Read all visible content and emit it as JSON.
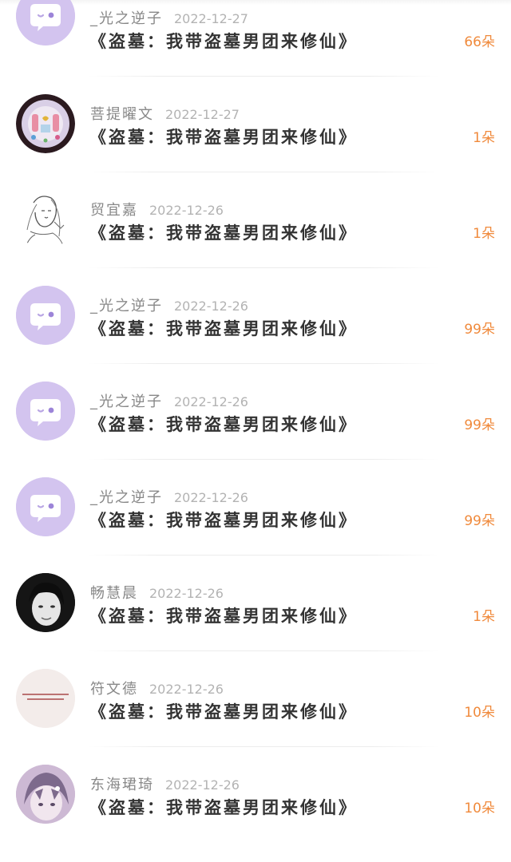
{
  "gift_records": [
    {
      "user": "_光之逆子",
      "date": "2022-12-27",
      "book": "《盗墓：我带盗墓男团来修仙》",
      "amount": "66朵",
      "avatar": "chat-bubble-avatar"
    },
    {
      "user": "菩提曜文",
      "date": "2022-12-27",
      "book": "《盗墓：我带盗墓男团来修仙》",
      "amount": "1朵",
      "avatar": "photo-avatar"
    },
    {
      "user": "贸宜嘉",
      "date": "2022-12-26",
      "book": "《盗墓：我带盗墓男团来修仙》",
      "amount": "1朵",
      "avatar": "sketch-avatar"
    },
    {
      "user": "_光之逆子",
      "date": "2022-12-26",
      "book": "《盗墓：我带盗墓男团来修仙》",
      "amount": "99朵",
      "avatar": "chat-bubble-avatar"
    },
    {
      "user": "_光之逆子",
      "date": "2022-12-26",
      "book": "《盗墓：我带盗墓男团来修仙》",
      "amount": "99朵",
      "avatar": "chat-bubble-avatar"
    },
    {
      "user": "_光之逆子",
      "date": "2022-12-26",
      "book": "《盗墓：我带盗墓男团来修仙》",
      "amount": "99朵",
      "avatar": "chat-bubble-avatar"
    },
    {
      "user": "畅慧晨",
      "date": "2022-12-26",
      "book": "《盗墓：我带盗墓男团来修仙》",
      "amount": "1朵",
      "avatar": "photo-avatar"
    },
    {
      "user": "符文德",
      "date": "2022-12-26",
      "book": "《盗墓：我带盗墓男团来修仙》",
      "amount": "10朵",
      "avatar": "text-image-avatar"
    },
    {
      "user": "东海珺琦",
      "date": "2022-12-26",
      "book": "《盗墓：我带盗墓男团来修仙》",
      "amount": "10朵",
      "avatar": "anime-avatar"
    }
  ],
  "colors": {
    "amount": "#f08a3c",
    "bubble_avatar_bg": "#d3c4ef",
    "title": "#333333",
    "username": "#888888",
    "date": "#b3b3b3"
  }
}
